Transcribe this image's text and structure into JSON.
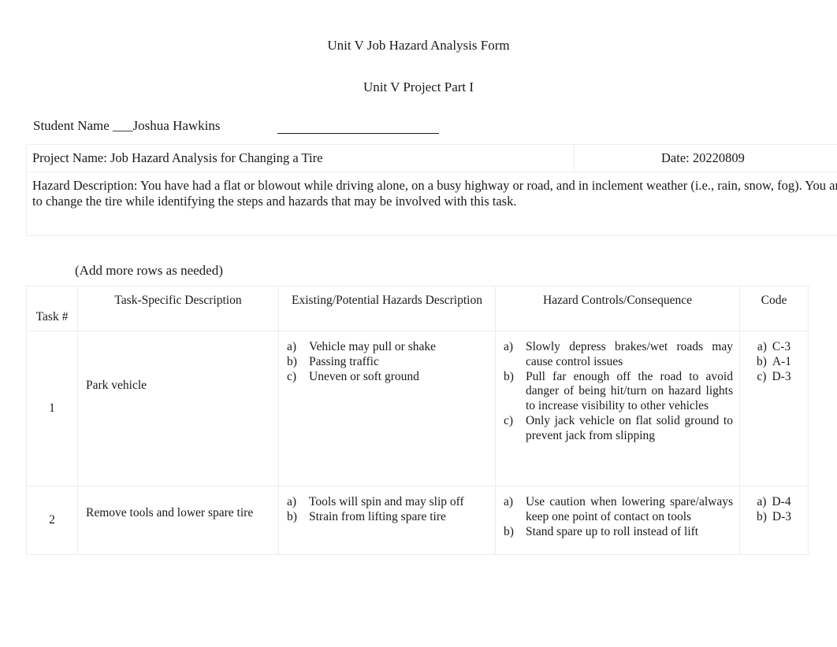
{
  "document": {
    "title": "Unit V Job Hazard Analysis Form",
    "subtitle": "Unit V Project Part I"
  },
  "student": {
    "label": "Student Name ___Joshua Hawkins"
  },
  "info": {
    "project_name": "Project Name: Job Hazard Analysis for Changing a Tire",
    "date": "Date: 20220809",
    "hazard_description": "Hazard Description: You have had a flat or blowout while driving alone, on a busy highway or road, and in inclement weather (i.e., rain, snow, fog). You are required to change the tire while identifying the steps and hazards that may be involved with this task."
  },
  "note": {
    "add_rows": "(Add more rows as needed)"
  },
  "table": {
    "headers": {
      "task_number": "Task #",
      "task_description": "Task-Specific Description",
      "hazards": "Existing/Potential Hazards Description",
      "controls": "Hazard Controls/Consequence",
      "code": "Code"
    },
    "rows": [
      {
        "task_number": "1",
        "task_description": "Park vehicle",
        "hazards": [
          {
            "marker": "a)",
            "text": "Vehicle may pull or shake"
          },
          {
            "marker": "b)",
            "text": "Passing traffic"
          },
          {
            "marker": "c)",
            "text": "Uneven or soft ground"
          }
        ],
        "controls": [
          {
            "marker": "a)",
            "text": "Slowly depress brakes/wet roads may cause control issues"
          },
          {
            "marker": "b)",
            "text": "Pull far enough off the road to avoid danger of being hit/turn on hazard lights to increase visibility to other vehicles"
          },
          {
            "marker": "c)",
            "text": "Only jack vehicle on flat solid ground to prevent jack from slipping"
          }
        ],
        "codes": [
          {
            "marker": "a)",
            "text": "C-3"
          },
          {
            "marker": "b)",
            "text": "A-1"
          },
          {
            "marker": "c)",
            "text": "D-3"
          }
        ]
      },
      {
        "task_number": "2",
        "task_description": "Remove tools and lower spare tire",
        "hazards": [
          {
            "marker": "a)",
            "text": "Tools will spin and may slip off"
          },
          {
            "marker": "b)",
            "text": "Strain from lifting spare tire"
          }
        ],
        "controls": [
          {
            "marker": "a)",
            "text": "Use caution when lowering spare/always keep one point of contact on tools"
          },
          {
            "marker": "b)",
            "text": "Stand spare up to roll instead of lift"
          }
        ],
        "codes": [
          {
            "marker": "a)",
            "text": "D-4"
          },
          {
            "marker": "b)",
            "text": "D-3"
          }
        ]
      }
    ]
  },
  "colors": {
    "text": "#1a1a1a",
    "border": "#ededed",
    "page_background": "#ffffff"
  }
}
